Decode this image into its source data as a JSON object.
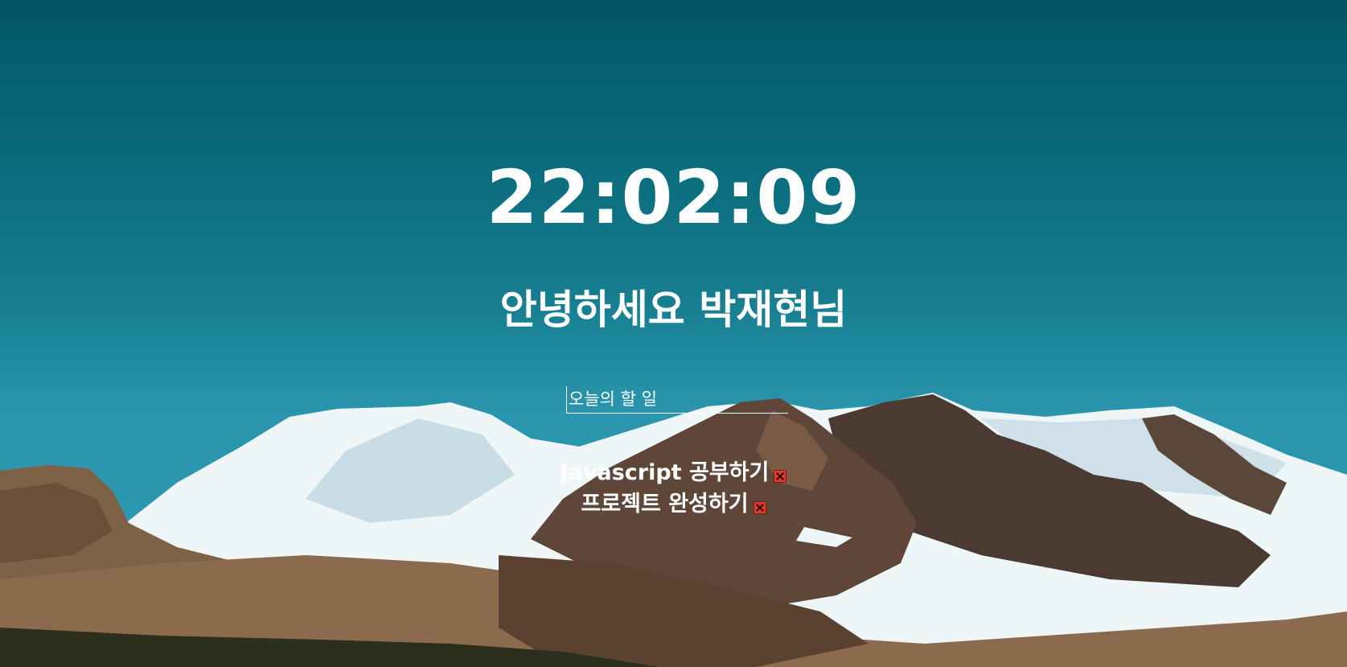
{
  "clock": {
    "time": "22:02:09"
  },
  "greeting": {
    "text": "안녕하세요 박재현님"
  },
  "todo_form": {
    "placeholder": "오늘의 할 일",
    "value": ""
  },
  "todos": [
    {
      "text": "Javascript 공부하기",
      "delete_icon": "close-icon"
    },
    {
      "text": "프로젝트 완성하기",
      "delete_icon": "close-icon"
    }
  ],
  "colors": {
    "sky_top": "#045564",
    "sky_bottom": "#2e9ab3",
    "text": "#ffffff",
    "delete": "#e23a2a"
  }
}
